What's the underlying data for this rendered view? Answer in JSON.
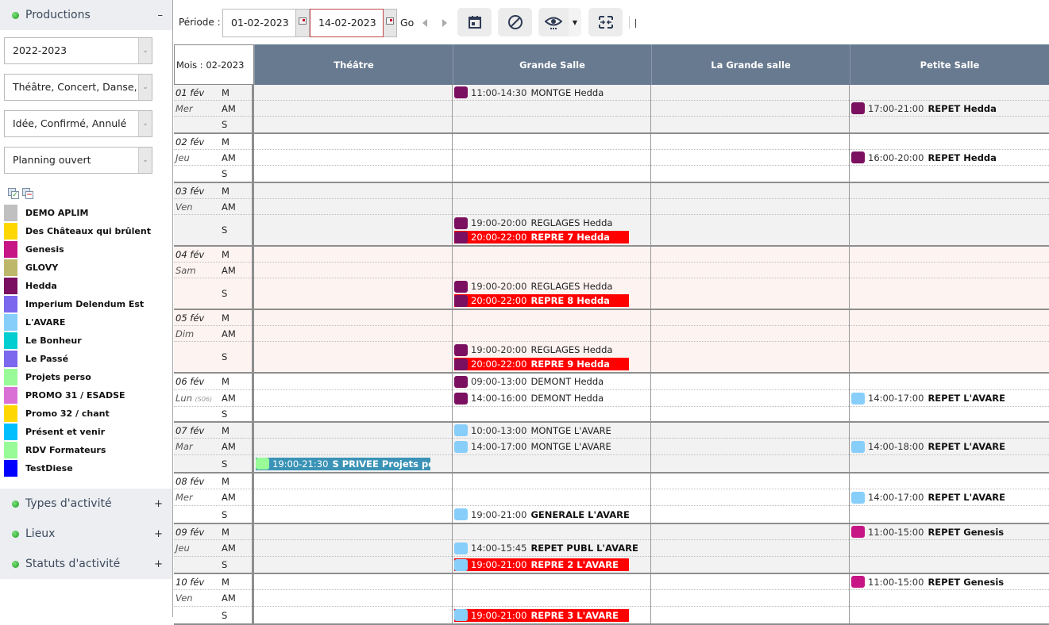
{
  "sidebar": {
    "productions": {
      "title": "Productions",
      "toggle": "–"
    },
    "selects": [
      {
        "value": "2022-2023"
      },
      {
        "value": "Théâtre, Concert, Danse, E"
      },
      {
        "value": "Idée, Confirmé, Annulé"
      },
      {
        "value": "Planning ouvert"
      }
    ],
    "legend": [
      {
        "label": "DEMO APLIM",
        "color": "#c0c0c0"
      },
      {
        "label": "Des Châteaux qui brûlent",
        "color": "#ffd700"
      },
      {
        "label": "Genesis",
        "color": "#c71585"
      },
      {
        "label": "GLOVY",
        "color": "#bdb76b"
      },
      {
        "label": "Hedda",
        "color": "#7b1060"
      },
      {
        "label": "Imperium Delendum Est",
        "color": "#7b68ee"
      },
      {
        "label": "L'AVARE",
        "color": "#87cefa"
      },
      {
        "label": "Le Bonheur",
        "color": "#00ced1"
      },
      {
        "label": "Le Passé",
        "color": "#7b68ee"
      },
      {
        "label": "Projets perso",
        "color": "#98fb98"
      },
      {
        "label": "PROMO 31 / ESADSE",
        "color": "#da70d6"
      },
      {
        "label": "Promo 32 / chant",
        "color": "#ffd700"
      },
      {
        "label": "Présent et venir",
        "color": "#00bfff"
      },
      {
        "label": "RDV Formateurs",
        "color": "#98fb98"
      },
      {
        "label": "TestDiese",
        "color": "#0000ff"
      }
    ],
    "groups": [
      {
        "title": "Types d'activité",
        "toggle": "+"
      },
      {
        "title": "Lieux",
        "toggle": "+"
      },
      {
        "title": "Statuts d'activité",
        "toggle": "+"
      }
    ]
  },
  "toolbar": {
    "periode_label": "Période :",
    "date_from": "01-02-2023",
    "date_to": "14-02-2023",
    "go_label": "Go"
  },
  "grid": {
    "month_label": "Mois : 02-2023",
    "columns": [
      "Théâtre",
      "Grande Salle",
      "La Grande salle",
      "Petite Salle"
    ],
    "slot_labels": [
      "M",
      "AM",
      "S"
    ],
    "days": [
      {
        "date": "01 fév",
        "weekday": "Mer",
        "week": "",
        "style": "odd",
        "heights": [
          20,
          20,
          20
        ],
        "events": [
          {
            "col": 1,
            "slot": 0,
            "time": "11:00-14:30",
            "name": "MONTGE Hedda",
            "color": "#7b1060",
            "kind": "normal"
          },
          {
            "col": 3,
            "slot": 1,
            "time": "17:00-21:00",
            "name": "REPET Hedda",
            "color": "#7b1060",
            "kind": "bold"
          }
        ]
      },
      {
        "date": "02 fév",
        "weekday": "Jeu",
        "week": "",
        "style": "even",
        "heights": [
          20,
          20,
          20
        ],
        "events": [
          {
            "col": 3,
            "slot": 1,
            "time": "16:00-20:00",
            "name": "REPET Hedda",
            "color": "#7b1060",
            "kind": "bold"
          }
        ]
      },
      {
        "date": "03 fév",
        "weekday": "Ven",
        "week": "",
        "style": "odd",
        "heights": [
          20,
          20,
          38
        ],
        "events": [
          {
            "col": 1,
            "slot": 2,
            "time": "19:00-20:00",
            "name": "REGLAGES Hedda",
            "color": "#7b1060",
            "kind": "normal"
          },
          {
            "col": 1,
            "slot": 2,
            "time": "20:00-22:00",
            "name": "REPRE 7 Hedda",
            "color": "#7b1060",
            "kind": "alert"
          }
        ]
      },
      {
        "date": "04 fév",
        "weekday": "Sam",
        "week": "",
        "style": "weekend",
        "heights": [
          20,
          20,
          38
        ],
        "events": [
          {
            "col": 1,
            "slot": 2,
            "time": "19:00-20:00",
            "name": "REGLAGES Hedda",
            "color": "#7b1060",
            "kind": "normal"
          },
          {
            "col": 1,
            "slot": 2,
            "time": "20:00-22:00",
            "name": "REPRE 8 Hedda",
            "color": "#7b1060",
            "kind": "alert"
          }
        ]
      },
      {
        "date": "05 fév",
        "weekday": "Dim",
        "week": "",
        "style": "weekend",
        "heights": [
          20,
          20,
          38
        ],
        "events": [
          {
            "col": 1,
            "slot": 2,
            "time": "19:00-20:00",
            "name": "REGLAGES Hedda",
            "color": "#7b1060",
            "kind": "normal"
          },
          {
            "col": 1,
            "slot": 2,
            "time": "20:00-22:00",
            "name": "REPRE 9 Hedda",
            "color": "#7b1060",
            "kind": "alert"
          }
        ]
      },
      {
        "date": "06 fév",
        "weekday": "Lun",
        "week": "(S06)",
        "style": "even",
        "heights": [
          21,
          21,
          18
        ],
        "events": [
          {
            "col": 1,
            "slot": 0,
            "time": "09:00-13:00",
            "name": "DEMONT Hedda",
            "color": "#7b1060",
            "kind": "normal"
          },
          {
            "col": 1,
            "slot": 1,
            "time": "14:00-16:00",
            "name": "DEMONT Hedda",
            "color": "#7b1060",
            "kind": "normal"
          },
          {
            "col": 3,
            "slot": 1,
            "time": "14:00-17:00",
            "name": "REPET L'AVARE",
            "color": "#87cefa",
            "kind": "bold"
          }
        ]
      },
      {
        "date": "07 fév",
        "weekday": "Mar",
        "week": "",
        "style": "odd",
        "heights": [
          20,
          21,
          21
        ],
        "events": [
          {
            "col": 1,
            "slot": 0,
            "time": "10:00-13:00",
            "name": "MONTGE L'AVARE",
            "color": "#87cefa",
            "kind": "normal"
          },
          {
            "col": 1,
            "slot": 1,
            "time": "14:00-17:00",
            "name": "MONTGE L'AVARE",
            "color": "#87cefa",
            "kind": "normal"
          },
          {
            "col": 3,
            "slot": 1,
            "time": "14:00-18:00",
            "name": "REPET L'AVARE",
            "color": "#87cefa",
            "kind": "bold"
          },
          {
            "col": 0,
            "slot": 2,
            "time": "19:00-21:30",
            "name": "S PRIVEE Projets perso",
            "color": "#98fb98",
            "kind": "private"
          }
        ]
      },
      {
        "date": "08 fév",
        "weekday": "Mer",
        "week": "",
        "style": "even",
        "heights": [
          20,
          21,
          21
        ],
        "events": [
          {
            "col": 3,
            "slot": 1,
            "time": "14:00-17:00",
            "name": "REPET L'AVARE",
            "color": "#87cefa",
            "kind": "bold"
          },
          {
            "col": 1,
            "slot": 2,
            "time": "19:00-21:00",
            "name": "GENERALE L'AVARE",
            "color": "#87cefa",
            "kind": "bold"
          }
        ]
      },
      {
        "date": "09 fév",
        "weekday": "Jeu",
        "week": "",
        "style": "odd",
        "heights": [
          20,
          21,
          20
        ],
        "events": [
          {
            "col": 3,
            "slot": 0,
            "time": "11:00-15:00",
            "name": "REPET Genesis",
            "color": "#c71585",
            "kind": "bold"
          },
          {
            "col": 1,
            "slot": 1,
            "time": "14:00-15:45",
            "name": "REPET PUBL L'AVARE",
            "color": "#87cefa",
            "kind": "bold"
          },
          {
            "col": 1,
            "slot": 2,
            "time": "19:00-21:00",
            "name": "REPRE 2 L'AVARE",
            "color": "#87cefa",
            "kind": "alert"
          }
        ]
      },
      {
        "date": "10 fév",
        "weekday": "Ven",
        "week": "",
        "style": "even",
        "heights": [
          20,
          21,
          21
        ],
        "events": [
          {
            "col": 3,
            "slot": 0,
            "time": "11:00-15:00",
            "name": "REPET Genesis",
            "color": "#c71585",
            "kind": "bold"
          },
          {
            "col": 1,
            "slot": 2,
            "time": "19:00-21:00",
            "name": "REPRE 3 L'AVARE",
            "color": "#87cefa",
            "kind": "alert"
          }
        ]
      }
    ]
  }
}
